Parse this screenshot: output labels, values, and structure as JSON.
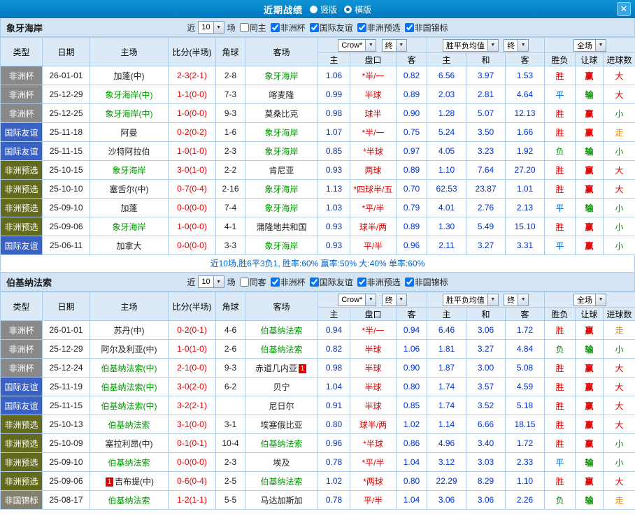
{
  "icons": {
    "chevron_down": "▼",
    "close": "✕"
  },
  "colors": {
    "titlebar_blue": "#0084c8",
    "badge_cup_gray": "#898989",
    "badge_friendly_blue": "#3a62c4",
    "badge_qualify_olive": "#636a1e",
    "badge_champ_taupe": "#857f6d",
    "win_red": "#e00000",
    "lose_green": "#009900",
    "draw_blue": "#0066dd",
    "push_orange": "#ff8a00"
  },
  "titlebar": {
    "title": "近期战绩",
    "layout_options": [
      {
        "label": "竖版",
        "checked": false
      },
      {
        "label": "横版",
        "checked": true
      }
    ]
  },
  "filter_labels": {
    "near": "近",
    "count": "10",
    "matches": "场"
  },
  "table_header": {
    "type": "类型",
    "date": "日期",
    "home": "主场",
    "score": "比分(半场)",
    "corner": "角球",
    "away": "客场",
    "dd_crow": "Crow*",
    "dd_end": "终",
    "dd_wdl": "胜平负均值",
    "dd_full": "全场",
    "sub_home": "主",
    "sub_handicap": "盘口",
    "sub_away": "客",
    "sub_win": "主",
    "sub_draw": "和",
    "sub_lose": "客",
    "sub_result": "胜负",
    "sub_rq": "让球",
    "sub_goals": "进球数"
  },
  "sections": [
    {
      "team": "象牙海岸",
      "filters": [
        {
          "label": "同主",
          "checked": false
        },
        {
          "label": "非洲杯",
          "checked": true
        },
        {
          "label": "国际友谊",
          "checked": true
        },
        {
          "label": "非洲预选",
          "checked": true
        },
        {
          "label": "非国锦标",
          "checked": true
        }
      ],
      "summary": "近10场,胜6平3负1, 胜率:60% 赢率:50% 大:40% 单率:60%",
      "rows": [
        {
          "type": "非洲杯",
          "type_class": "t-cup",
          "date": "26-01-01",
          "home": "加蓬(中)",
          "home_class": "",
          "home_badge": "",
          "score": "2-3(2-1)",
          "corner": "2-8",
          "away": "象牙海岸",
          "away_class": "tm-green",
          "away_badge": "",
          "o_home": "1.06",
          "handicap": "*半/一",
          "o_away": "0.82",
          "avg_w": "6.56",
          "avg_d": "3.97",
          "avg_l": "1.53",
          "res": "胜",
          "res_class": "c-red",
          "rq": "赢",
          "rq_class": "c-red",
          "goal": "大",
          "goal_class": "c-red"
        },
        {
          "type": "非洲杯",
          "type_class": "t-cup",
          "date": "25-12-29",
          "home": "象牙海岸(中)",
          "home_class": "tm-green",
          "home_badge": "",
          "score": "1-1(0-0)",
          "corner": "7-3",
          "away": "喀麦隆",
          "away_class": "",
          "away_badge": "",
          "o_home": "0.99",
          "handicap": "半球",
          "o_away": "0.89",
          "avg_w": "2.03",
          "avg_d": "2.81",
          "avg_l": "4.64",
          "res": "平",
          "res_class": "c-blue",
          "rq": "输",
          "rq_class": "c-green",
          "goal": "大",
          "goal_class": "c-red"
        },
        {
          "type": "非洲杯",
          "type_class": "t-cup",
          "date": "25-12-25",
          "home": "象牙海岸(中)",
          "home_class": "tm-green",
          "home_badge": "",
          "score": "1-0(0-0)",
          "corner": "9-3",
          "away": "莫桑比克",
          "away_class": "",
          "away_badge": "",
          "o_home": "0.98",
          "handicap": "球半",
          "o_away": "0.90",
          "avg_w": "1.28",
          "avg_d": "5.07",
          "avg_l": "12.13",
          "res": "胜",
          "res_class": "c-red",
          "rq": "赢",
          "rq_class": "c-red",
          "goal": "小",
          "goal_class": "c-green"
        },
        {
          "type": "国际友谊",
          "type_class": "t-friendly",
          "date": "25-11-18",
          "home": "阿曼",
          "home_class": "",
          "home_badge": "",
          "score": "0-2(0-2)",
          "corner": "1-6",
          "away": "象牙海岸",
          "away_class": "tm-green",
          "away_badge": "",
          "o_home": "1.07",
          "handicap": "*半/一",
          "o_away": "0.75",
          "avg_w": "5.24",
          "avg_d": "3.50",
          "avg_l": "1.66",
          "res": "胜",
          "res_class": "c-red",
          "rq": "赢",
          "rq_class": "c-red",
          "goal": "走",
          "goal_class": "c-orange"
        },
        {
          "type": "国际友谊",
          "type_class": "t-friendly",
          "date": "25-11-15",
          "home": "沙特阿拉伯",
          "home_class": "",
          "home_badge": "",
          "score": "1-0(1-0)",
          "corner": "2-3",
          "away": "象牙海岸",
          "away_class": "tm-green",
          "away_badge": "",
          "o_home": "0.85",
          "handicap": "*半球",
          "o_away": "0.97",
          "avg_w": "4.05",
          "avg_d": "3.23",
          "avg_l": "1.92",
          "res": "负",
          "res_class": "c-green",
          "rq": "输",
          "rq_class": "c-green",
          "goal": "小",
          "goal_class": "c-green"
        },
        {
          "type": "非洲预选",
          "type_class": "t-qualify",
          "date": "25-10-15",
          "home": "象牙海岸",
          "home_class": "tm-green",
          "home_badge": "",
          "score": "3-0(1-0)",
          "corner": "2-2",
          "away": "肯尼亚",
          "away_class": "",
          "away_badge": "",
          "o_home": "0.93",
          "handicap": "两球",
          "o_away": "0.89",
          "avg_w": "1.10",
          "avg_d": "7.64",
          "avg_l": "27.20",
          "res": "胜",
          "res_class": "c-red",
          "rq": "赢",
          "rq_class": "c-red",
          "goal": "大",
          "goal_class": "c-red"
        },
        {
          "type": "非洲预选",
          "type_class": "t-qualify",
          "date": "25-10-10",
          "home": "塞舌尔(中)",
          "home_class": "",
          "home_badge": "",
          "score": "0-7(0-4)",
          "corner": "2-16",
          "away": "象牙海岸",
          "away_class": "tm-green",
          "away_badge": "",
          "o_home": "1.13",
          "handicap": "*四球半/五",
          "o_away": "0.70",
          "avg_w": "62.53",
          "avg_d": "23.87",
          "avg_l": "1.01",
          "res": "胜",
          "res_class": "c-red",
          "rq": "赢",
          "rq_class": "c-red",
          "goal": "大",
          "goal_class": "c-red"
        },
        {
          "type": "非洲预选",
          "type_class": "t-qualify",
          "date": "25-09-10",
          "home": "加蓬",
          "home_class": "",
          "home_badge": "",
          "score": "0-0(0-0)",
          "corner": "7-4",
          "away": "象牙海岸",
          "away_class": "tm-green",
          "away_badge": "",
          "o_home": "1.03",
          "handicap": "*平/半",
          "o_away": "0.79",
          "avg_w": "4.01",
          "avg_d": "2.76",
          "avg_l": "2.13",
          "res": "平",
          "res_class": "c-blue",
          "rq": "输",
          "rq_class": "c-green",
          "goal": "小",
          "goal_class": "c-green"
        },
        {
          "type": "非洲预选",
          "type_class": "t-qualify",
          "date": "25-09-06",
          "home": "象牙海岸",
          "home_class": "tm-green",
          "home_badge": "",
          "score": "1-0(0-0)",
          "corner": "4-1",
          "away": "蒲隆地共和国",
          "away_class": "",
          "away_badge": "",
          "o_home": "0.93",
          "handicap": "球半/两",
          "o_away": "0.89",
          "avg_w": "1.30",
          "avg_d": "5.49",
          "avg_l": "15.10",
          "res": "胜",
          "res_class": "c-red",
          "rq": "赢",
          "rq_class": "c-red",
          "goal": "小",
          "goal_class": "c-green"
        },
        {
          "type": "国际友谊",
          "type_class": "t-friendly",
          "date": "25-06-11",
          "home": "加拿大",
          "home_class": "",
          "home_badge": "",
          "score": "0-0(0-0)",
          "corner": "3-3",
          "away": "象牙海岸",
          "away_class": "tm-green",
          "away_badge": "",
          "o_home": "0.93",
          "handicap": "平/半",
          "o_away": "0.96",
          "avg_w": "2.11",
          "avg_d": "3.27",
          "avg_l": "3.31",
          "res": "平",
          "res_class": "c-blue",
          "rq": "赢",
          "rq_class": "c-red",
          "goal": "小",
          "goal_class": "c-green"
        }
      ]
    },
    {
      "team": "伯基纳法索",
      "filters": [
        {
          "label": "同客",
          "checked": false
        },
        {
          "label": "非洲杯",
          "checked": true
        },
        {
          "label": "国际友谊",
          "checked": true
        },
        {
          "label": "非洲预选",
          "checked": true
        },
        {
          "label": "非国锦标",
          "checked": true
        }
      ],
      "summary": "",
      "rows": [
        {
          "type": "非洲杯",
          "type_class": "t-cup",
          "date": "26-01-01",
          "home": "苏丹(中)",
          "home_class": "",
          "home_badge": "",
          "score": "0-2(0-1)",
          "corner": "4-6",
          "away": "伯基纳法索",
          "away_class": "tm-green",
          "away_badge": "",
          "o_home": "0.94",
          "handicap": "*半/一",
          "o_away": "0.94",
          "avg_w": "6.46",
          "avg_d": "3.06",
          "avg_l": "1.72",
          "res": "胜",
          "res_class": "c-red",
          "rq": "赢",
          "rq_class": "c-red",
          "goal": "走",
          "goal_class": "c-orange"
        },
        {
          "type": "非洲杯",
          "type_class": "t-cup",
          "date": "25-12-29",
          "home": "阿尔及利亚(中)",
          "home_class": "",
          "home_badge": "",
          "score": "1-0(1-0)",
          "corner": "2-6",
          "away": "伯基纳法索",
          "away_class": "tm-green",
          "away_badge": "",
          "o_home": "0.82",
          "handicap": "半球",
          "o_away": "1.06",
          "avg_w": "1.81",
          "avg_d": "3.27",
          "avg_l": "4.84",
          "res": "负",
          "res_class": "c-green",
          "rq": "输",
          "rq_class": "c-green",
          "goal": "小",
          "goal_class": "c-green"
        },
        {
          "type": "非洲杯",
          "type_class": "t-cup",
          "date": "25-12-24",
          "home": "伯基纳法索(中)",
          "home_class": "tm-green",
          "home_badge": "",
          "score": "2-1(0-0)",
          "corner": "9-3",
          "away": "赤道几内亚",
          "away_class": "",
          "away_badge": "1",
          "o_home": "0.98",
          "handicap": "半球",
          "o_away": "0.90",
          "avg_w": "1.87",
          "avg_d": "3.00",
          "avg_l": "5.08",
          "res": "胜",
          "res_class": "c-red",
          "rq": "赢",
          "rq_class": "c-red",
          "goal": "大",
          "goal_class": "c-red"
        },
        {
          "type": "国际友谊",
          "type_class": "t-friendly",
          "date": "25-11-19",
          "home": "伯基纳法索(中)",
          "home_class": "tm-green",
          "home_badge": "",
          "score": "3-0(2-0)",
          "corner": "6-2",
          "away": "贝宁",
          "away_class": "",
          "away_badge": "",
          "o_home": "1.04",
          "handicap": "半球",
          "o_away": "0.80",
          "avg_w": "1.74",
          "avg_d": "3.57",
          "avg_l": "4.59",
          "res": "胜",
          "res_class": "c-red",
          "rq": "赢",
          "rq_class": "c-red",
          "goal": "大",
          "goal_class": "c-red"
        },
        {
          "type": "国际友谊",
          "type_class": "t-friendly",
          "date": "25-11-15",
          "home": "伯基纳法索(中)",
          "home_class": "tm-green",
          "home_badge": "",
          "score": "3-2(2-1)",
          "corner": "",
          "away": "尼日尔",
          "away_class": "",
          "away_badge": "",
          "o_home": "0.91",
          "handicap": "半球",
          "o_away": "0.85",
          "avg_w": "1.74",
          "avg_d": "3.52",
          "avg_l": "5.18",
          "res": "胜",
          "res_class": "c-red",
          "rq": "赢",
          "rq_class": "c-red",
          "goal": "大",
          "goal_class": "c-red"
        },
        {
          "type": "非洲预选",
          "type_class": "t-qualify",
          "date": "25-10-13",
          "home": "伯基纳法索",
          "home_class": "tm-green",
          "home_badge": "",
          "score": "3-1(0-0)",
          "corner": "3-1",
          "away": "埃塞俄比亚",
          "away_class": "",
          "away_badge": "",
          "o_home": "0.80",
          "handicap": "球半/两",
          "o_away": "1.02",
          "avg_w": "1.14",
          "avg_d": "6.66",
          "avg_l": "18.15",
          "res": "胜",
          "res_class": "c-red",
          "rq": "赢",
          "rq_class": "c-red",
          "goal": "大",
          "goal_class": "c-red"
        },
        {
          "type": "非洲预选",
          "type_class": "t-qualify",
          "date": "25-10-09",
          "home": "塞拉利昂(中)",
          "home_class": "",
          "home_badge": "",
          "score": "0-1(0-1)",
          "corner": "10-4",
          "away": "伯基纳法索",
          "away_class": "tm-green",
          "away_badge": "",
          "o_home": "0.96",
          "handicap": "*半球",
          "o_away": "0.86",
          "avg_w": "4.96",
          "avg_d": "3.40",
          "avg_l": "1.72",
          "res": "胜",
          "res_class": "c-red",
          "rq": "赢",
          "rq_class": "c-red",
          "goal": "小",
          "goal_class": "c-green"
        },
        {
          "type": "非洲预选",
          "type_class": "t-qualify",
          "date": "25-09-10",
          "home": "伯基纳法索",
          "home_class": "tm-green",
          "home_badge": "",
          "score": "0-0(0-0)",
          "corner": "2-3",
          "away": "埃及",
          "away_class": "",
          "away_badge": "",
          "o_home": "0.78",
          "handicap": "*平/半",
          "o_away": "1.04",
          "avg_w": "3.12",
          "avg_d": "3.03",
          "avg_l": "2.33",
          "res": "平",
          "res_class": "c-blue",
          "rq": "输",
          "rq_class": "c-green",
          "goal": "小",
          "goal_class": "c-green"
        },
        {
          "type": "非洲预选",
          "type_class": "t-qualify",
          "date": "25-09-06",
          "home": "吉布提(中)",
          "home_class": "",
          "home_badge": "1",
          "score": "0-6(0-4)",
          "corner": "2-5",
          "away": "伯基纳法索",
          "away_class": "tm-green",
          "away_badge": "",
          "o_home": "1.02",
          "handicap": "*两球",
          "o_away": "0.80",
          "avg_w": "22.29",
          "avg_d": "8.29",
          "avg_l": "1.10",
          "res": "胜",
          "res_class": "c-red",
          "rq": "赢",
          "rq_class": "c-red",
          "goal": "大",
          "goal_class": "c-red"
        },
        {
          "type": "非国锦标",
          "type_class": "t-champ",
          "date": "25-08-17",
          "home": "伯基纳法索",
          "home_class": "tm-green",
          "home_badge": "",
          "score": "1-2(1-1)",
          "corner": "5-5",
          "away": "马达加斯加",
          "away_class": "",
          "away_badge": "",
          "o_home": "0.78",
          "handicap": "平/半",
          "o_away": "1.04",
          "avg_w": "3.06",
          "avg_d": "3.06",
          "avg_l": "2.26",
          "res": "负",
          "res_class": "c-green",
          "rq": "输",
          "rq_class": "c-green",
          "goal": "走",
          "goal_class": "c-orange"
        }
      ]
    }
  ]
}
